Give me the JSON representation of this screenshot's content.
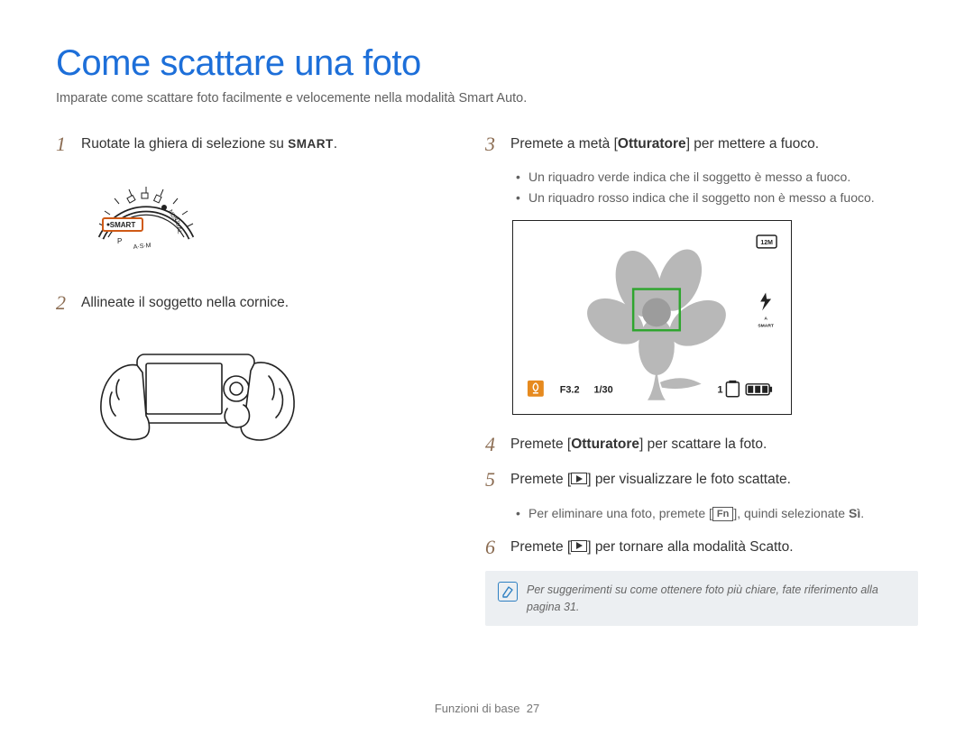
{
  "title": "Come scattare una foto",
  "subtitle": "Imparate come scattare foto facilmente e velocemente nella modalità Smart Auto.",
  "smart_label": "SMART",
  "steps": {
    "s1": {
      "num": "1",
      "text_a": "Ruotate la ghiera di selezione su ",
      "text_b": "."
    },
    "s2": {
      "num": "2",
      "text": "Allineate il soggetto nella cornice."
    },
    "s3": {
      "num": "3",
      "text_a": "Premete a metà [",
      "bold": "Otturatore",
      "text_b": "] per mettere a fuoco.",
      "bullets": [
        "Un riquadro verde indica che il soggetto è messo a fuoco.",
        "Un riquadro rosso indica che il soggetto non è messo a fuoco."
      ]
    },
    "s4": {
      "num": "4",
      "text_a": "Premete [",
      "bold": "Otturatore",
      "text_b": "] per scattare la foto."
    },
    "s5": {
      "num": "5",
      "text_a": "Premete [",
      "text_b": "] per visualizzare le foto scattate.",
      "bullets_a": "Per eliminare una foto, premete [",
      "fn": "Fn",
      "bullets_b": "], quindi selezionate ",
      "bullets_bold": "Sì",
      "bullets_c": "."
    },
    "s6": {
      "num": "6",
      "text_a": "Premete [",
      "text_b": "] per tornare alla modalità Scatto."
    }
  },
  "lcd": {
    "aperture": "F3.2",
    "shutter": "1/30",
    "battery_count": "1",
    "res_icon": "12M"
  },
  "tip": {
    "text": "Per suggerimenti su come ottenere foto più chiare, fate riferimento alla pagina 31."
  },
  "footer": {
    "section": "Funzioni di base",
    "page": "27"
  }
}
